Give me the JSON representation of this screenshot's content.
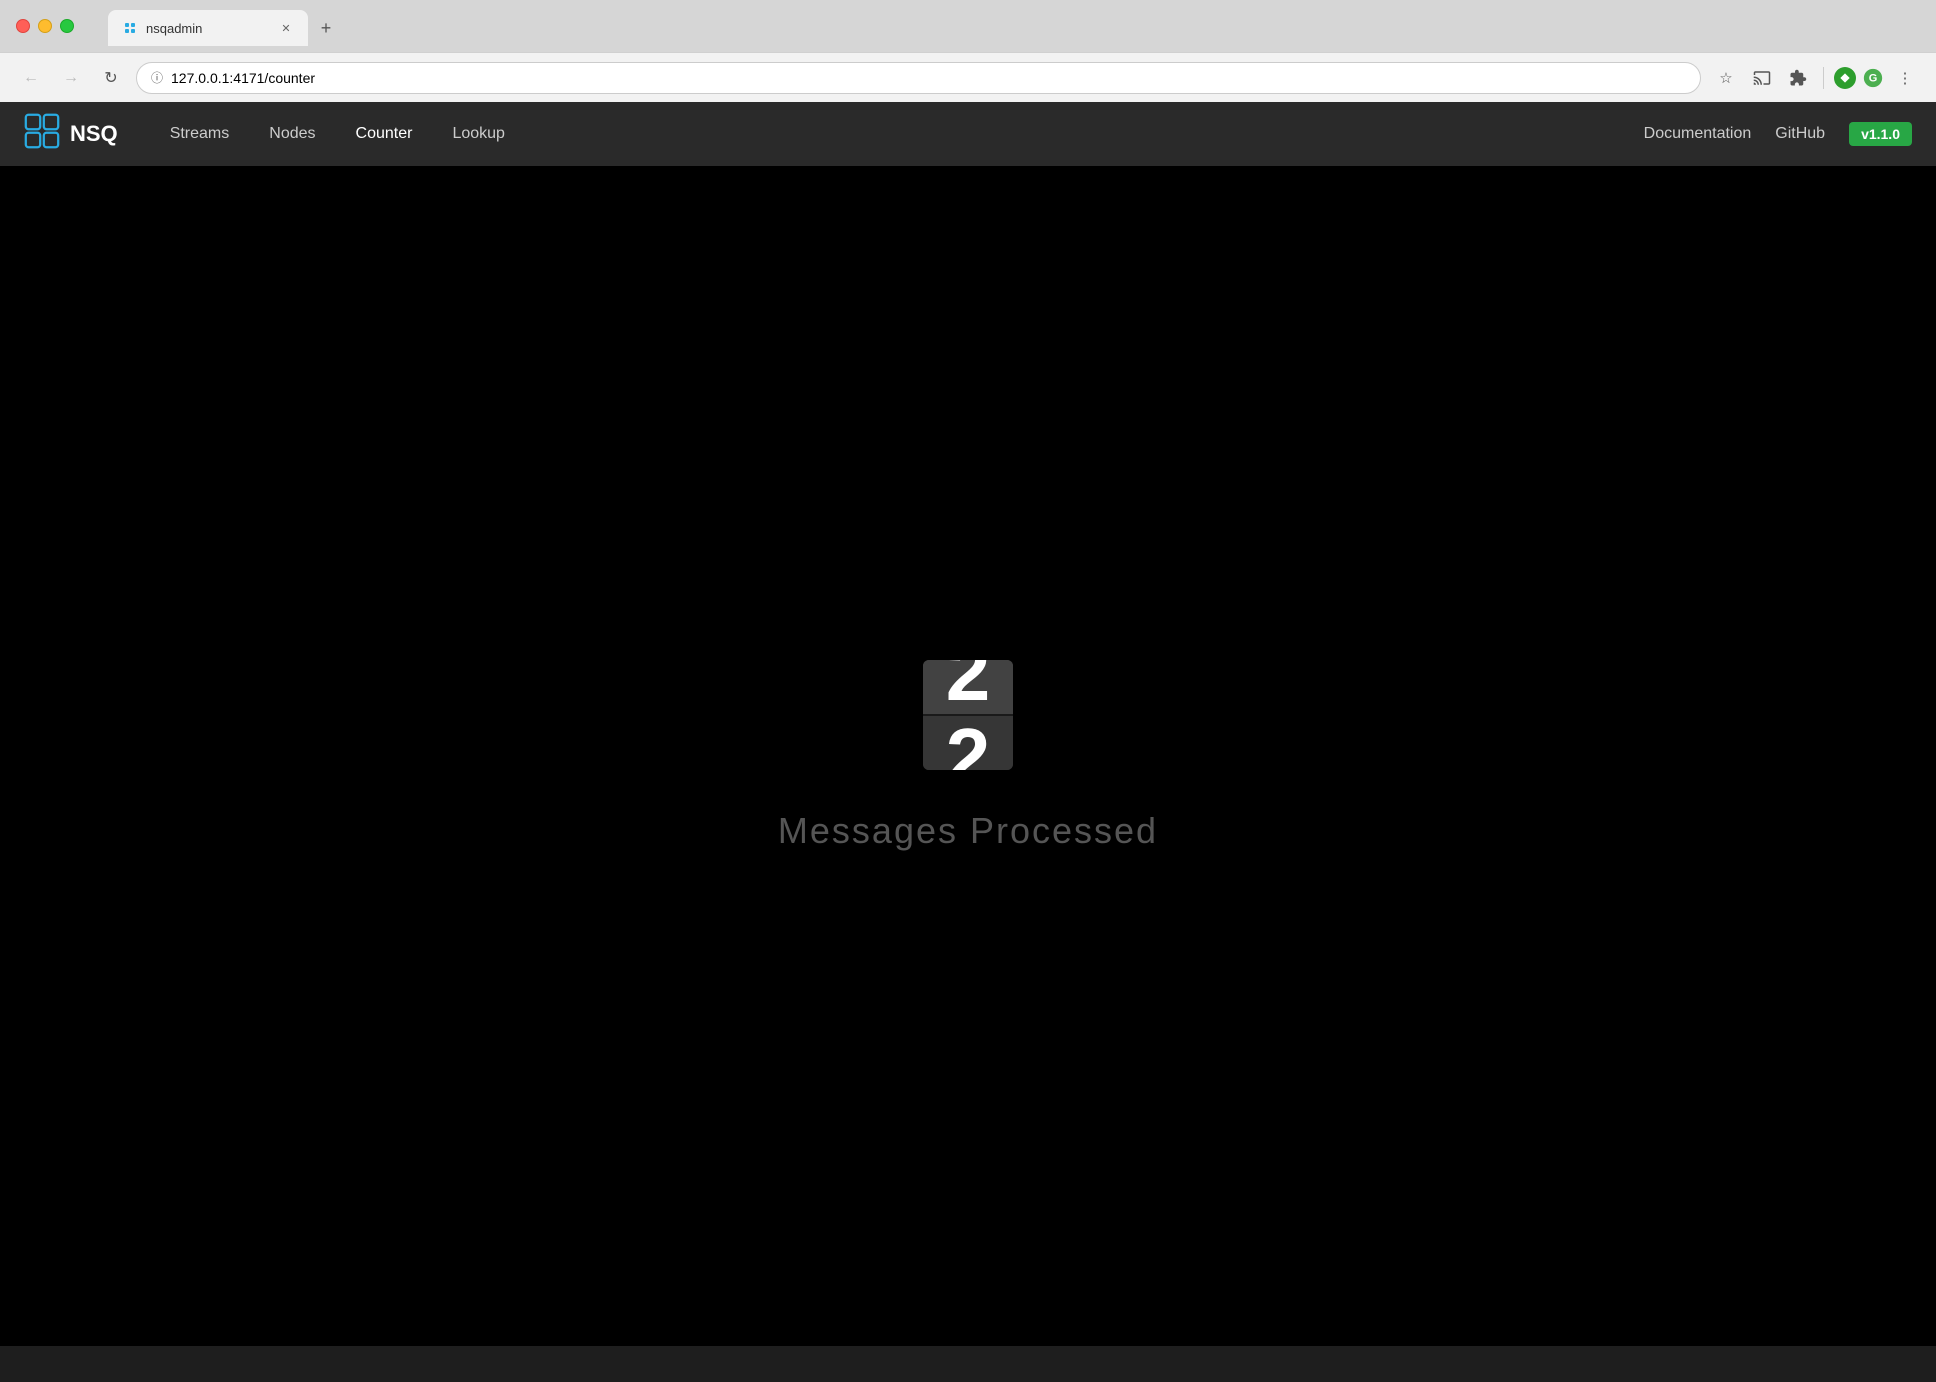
{
  "browser": {
    "tab_title": "nsqadmin",
    "tab_favicon": "nsq-icon",
    "url_display": "127.0.0.1:4171/counter",
    "url_host": "127.0.0.1",
    "url_port_path": ":4171/counter",
    "new_tab_symbol": "+"
  },
  "navbar": {
    "logo_text": "NSQ",
    "links": [
      {
        "label": "Streams",
        "href": "/streams",
        "active": false
      },
      {
        "label": "Nodes",
        "href": "/nodes",
        "active": false
      },
      {
        "label": "Counter",
        "href": "/counter",
        "active": true
      },
      {
        "label": "Lookup",
        "href": "/lookup",
        "active": false
      }
    ],
    "right_links": [
      {
        "label": "Documentation"
      },
      {
        "label": "GitHub"
      }
    ],
    "version": "v1.1.0"
  },
  "counter": {
    "value": "2",
    "label": "Messages Processed"
  }
}
